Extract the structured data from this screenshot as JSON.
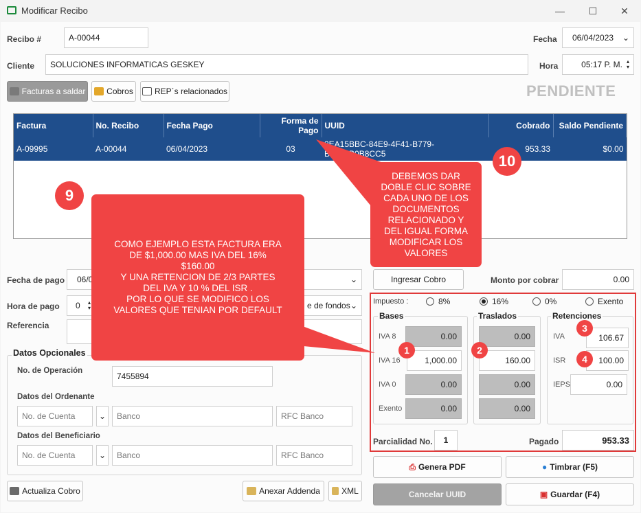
{
  "window": {
    "title": "Modificar Recibo",
    "minimize": "—",
    "maximize": "☐",
    "close": "✕"
  },
  "header": {
    "recibo_label": "Recibo #",
    "recibo_value": "A-00044",
    "fecha_label": "Fecha",
    "fecha_value": "06/04/2023",
    "cliente_label": "Cliente",
    "cliente_value": "SOLUCIONES INFORMATICAS GESKEY",
    "hora_label": "Hora",
    "hora_value": "05:17 P. M.",
    "status": "PENDIENTE"
  },
  "toolbar": {
    "facturas": "Facturas a saldar",
    "cobros": "Cobros",
    "rep": "REP´s relacionados"
  },
  "grid": {
    "columns": [
      "Factura",
      "No. Recibo",
      "Fecha Pago",
      "Forma de Pago",
      "UUID",
      "Cobrado",
      "Saldo Pendiente"
    ],
    "rows": [
      [
        "A-09995",
        "A-00044",
        "06/04/2023",
        "03",
        "2EA15BBC-84E9-4F41-B779-B0A96B0B8CC5",
        "953.33",
        "$0.00"
      ]
    ]
  },
  "pago": {
    "fecha_label": "Fecha de pago",
    "fecha_value": "06/0",
    "hora_label": "Hora de pago",
    "hora_value": "0",
    "forma_value": "e de fondos",
    "referencia_label": "Referencia"
  },
  "opcionales": {
    "title": "Datos Opcionales",
    "operacion_label": "No. de Operación",
    "operacion_value": "7455894",
    "ordenante_label": "Datos del Ordenante",
    "beneficiario_label": "Datos del Beneficiario",
    "cuenta_ph": "No. de Cuenta",
    "banco_ph": "Banco",
    "rfc_ph": "RFC Banco"
  },
  "cobro": {
    "ingresar": "Ingresar Cobro",
    "monto_label": "Monto por cobrar",
    "monto_value": "0.00"
  },
  "impuesto": {
    "label": "Impuesto :",
    "options": [
      "8%",
      "16%",
      "0%",
      "Exento"
    ],
    "selected": "16%",
    "bases_title": "Bases",
    "traslados_title": "Traslados",
    "retenciones_title": "Retenciones",
    "bases": [
      {
        "label": "IVA 8",
        "value": "0.00"
      },
      {
        "label": "IVA 16",
        "value": "1,000.00"
      },
      {
        "label": "IVA 0",
        "value": "0.00"
      },
      {
        "label": "Exento",
        "value": "0.00"
      }
    ],
    "traslados": [
      "0.00",
      "160.00",
      "0.00",
      "0.00"
    ],
    "retenciones": [
      {
        "label": "IVA",
        "value": "106.67"
      },
      {
        "label": "ISR",
        "value": "100.00"
      },
      {
        "label": "IEPS",
        "value": "0.00"
      }
    ],
    "parcialidad_label": "Parcialidad No.",
    "parcialidad_value": "1",
    "pagado_label": "Pagado",
    "pagado_value": "953.33"
  },
  "actions": {
    "pdf": "Genera PDF",
    "timbrar": "Timbrar (F5)",
    "cancelar": "Cancelar UUID",
    "guardar": "Guardar (F4)",
    "actualiza": "Actualiza Cobro",
    "addenda": "Anexar Addenda",
    "xml": "XML"
  },
  "annotations": {
    "badge9": "9",
    "badge10": "10",
    "n1": "1",
    "n2": "2",
    "n3": "3",
    "n4": "4",
    "callout_left": [
      "COMO EJEMPLO ESTA FACTURA ERA",
      "DE $1,000.00 MAS IVA DEL 16%",
      "$160.00",
      "Y UNA RETENCION DE 2/3 PARTES",
      "DEL IVA Y 10 % DEL ISR .",
      "POR LO QUE SE MODIFICO LOS",
      "VALORES QUE TENIAN POR DEFAULT"
    ],
    "callout_right": [
      "DEBEMOS DAR",
      "DOBLE CLIC SOBRE",
      "CADA UNO DE LOS",
      "DOCUMENTOS",
      "RELACIONADO Y",
      "DEL IGUAL FORMA",
      "MODIFICAR LOS",
      "VALORES"
    ]
  },
  "colors": {
    "annotation": "#f04444",
    "grid_header": "#1f4e8c",
    "status": "#c0c0c0"
  }
}
